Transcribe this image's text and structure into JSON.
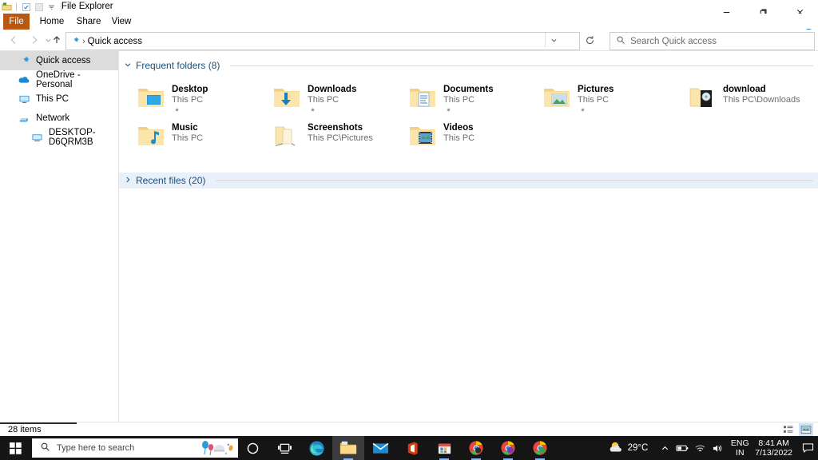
{
  "window": {
    "title": "File Explorer",
    "quick_access_toolbar": [
      "explorer-icon",
      "properties-icon",
      "new-folder-icon",
      "customize-dropdown-icon"
    ],
    "controls": {
      "minimize": "−",
      "restore": "❐",
      "close": "✕",
      "ribbon_toggle": "chevron-down-icon",
      "help": "?"
    }
  },
  "ribbon": {
    "tabs": [
      {
        "label": "File",
        "active": true
      },
      {
        "label": "Home",
        "active": false
      },
      {
        "label": "Share",
        "active": false
      },
      {
        "label": "View",
        "active": false
      }
    ],
    "file_tab_color": "#b75813"
  },
  "address_bar": {
    "back_tooltip": "Back",
    "forward_tooltip": "Forward",
    "recent_tooltip": "Recent locations",
    "up_tooltip": "Up",
    "breadcrumb": "Quick access",
    "breadcrumb_separator": "›",
    "refresh_tooltip": "Refresh",
    "dropdown_tooltip": "Previous locations"
  },
  "search": {
    "placeholder": "Search Quick access",
    "value": ""
  },
  "sidebar": {
    "items": [
      {
        "label": "Quick access",
        "icon": "pin-icon",
        "selected": true,
        "indent": false
      },
      {
        "label": "OneDrive - Personal",
        "icon": "onedrive-cloud-icon",
        "selected": false,
        "indent": false
      },
      {
        "label": "This PC",
        "icon": "monitor-icon",
        "selected": false,
        "indent": false
      },
      {
        "label": "Network",
        "icon": "network-icon",
        "selected": false,
        "indent": false
      },
      {
        "label": "DESKTOP-D6QRM3B",
        "icon": "computer-icon",
        "selected": false,
        "indent": true
      }
    ]
  },
  "main": {
    "groups": [
      {
        "id": "frequent",
        "label": "Frequent folders (8)",
        "expanded": true,
        "chevron": "chevron-down-icon"
      },
      {
        "id": "recent",
        "label": "Recent files (20)",
        "expanded": false,
        "chevron": "chevron-right-icon"
      }
    ],
    "frequent_folders": [
      {
        "name": "Desktop",
        "location": "This PC",
        "icon": "folder-desktop-icon",
        "pinned": true,
        "col": 0,
        "row": 0
      },
      {
        "name": "Downloads",
        "location": "This PC",
        "icon": "folder-downloads-icon",
        "pinned": true,
        "col": 1,
        "row": 0
      },
      {
        "name": "Documents",
        "location": "This PC",
        "icon": "folder-documents-icon",
        "pinned": true,
        "col": 2,
        "row": 0
      },
      {
        "name": "Pictures",
        "location": "This PC",
        "icon": "folder-pictures-icon",
        "pinned": true,
        "col": 3,
        "row": 0
      },
      {
        "name": "download",
        "location": "This PC\\Downloads",
        "icon": "folder-open-disc-icon",
        "pinned": false,
        "col": 4,
        "row": 0
      },
      {
        "name": "Music",
        "location": "This PC",
        "icon": "folder-music-icon",
        "pinned": false,
        "col": 0,
        "row": 1
      },
      {
        "name": "Screenshots",
        "location": "This PC\\Pictures",
        "icon": "folder-empty-icon",
        "pinned": false,
        "col": 1,
        "row": 1
      },
      {
        "name": "Videos",
        "location": "This PC",
        "icon": "folder-videos-icon",
        "pinned": false,
        "col": 2,
        "row": 1
      }
    ]
  },
  "status_bar": {
    "item_count": "28 items",
    "view_buttons": [
      {
        "name": "details-view-button",
        "active": false
      },
      {
        "name": "large-icons-view-button",
        "active": true
      }
    ]
  },
  "taskbar": {
    "start_tooltip": "Start",
    "search_placeholder": "Type here to search",
    "apps": [
      {
        "name": "cortana-icon",
        "active": false,
        "running": false
      },
      {
        "name": "task-view-icon",
        "active": false,
        "running": false
      },
      {
        "name": "edge-icon",
        "active": false,
        "running": false
      },
      {
        "name": "file-explorer-icon",
        "active": true,
        "running": true
      },
      {
        "name": "mail-icon",
        "active": false,
        "running": false
      },
      {
        "name": "office-icon",
        "active": false,
        "running": false
      },
      {
        "name": "microsoft-store-icon",
        "active": false,
        "running": true
      },
      {
        "name": "chrome-app-icon",
        "active": false,
        "running": true
      },
      {
        "name": "chrome-tv-app-icon",
        "active": false,
        "running": true
      },
      {
        "name": "chrome-p-app-icon",
        "active": false,
        "running": true
      }
    ],
    "tray": {
      "weather_temp": "29°C",
      "weather_icon": "sun-cloud-icon",
      "overflow": "chevron-up-icon",
      "battery": "battery-icon",
      "network": "wifi-icon",
      "volume": "speaker-icon",
      "language_line1": "ENG",
      "language_line2": "IN",
      "time": "8:41 AM",
      "date": "7/13/2022",
      "action_center": "action-center-icon"
    }
  },
  "colors": {
    "accent": "#0078d7",
    "file_tab": "#b75813",
    "group_header": "#1a4f7a",
    "recent_bg": "#e8f1fa",
    "selection": "#dcdcdc",
    "folder": "#f7d98b",
    "taskbar": "#151515"
  }
}
